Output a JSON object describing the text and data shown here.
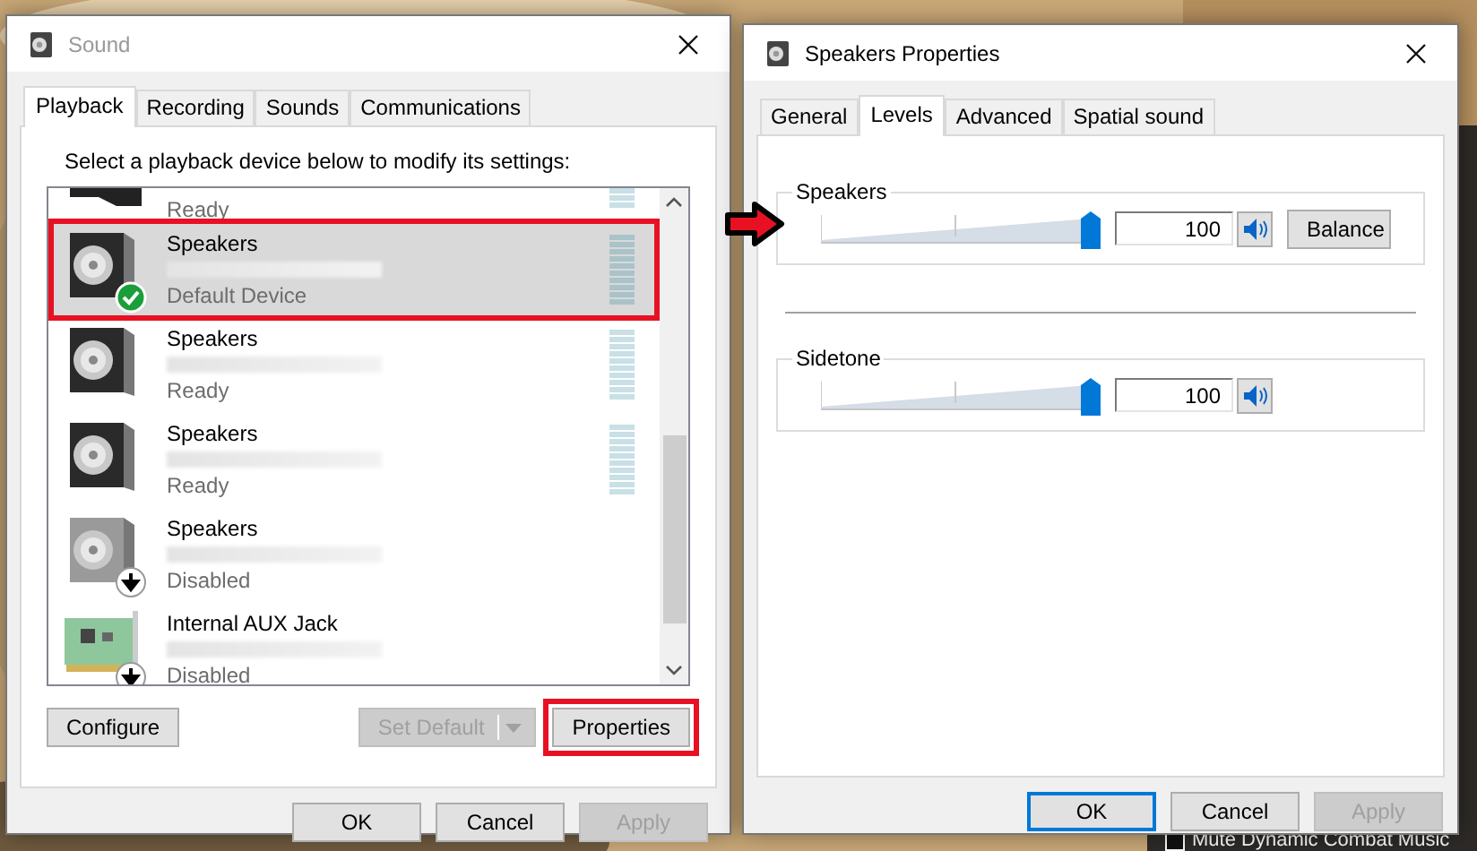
{
  "sound_window": {
    "title": "Sound",
    "tabs": [
      {
        "label": "Playback",
        "selected": true
      },
      {
        "label": "Recording",
        "selected": false
      },
      {
        "label": "Sounds",
        "selected": false
      },
      {
        "label": "Communications",
        "selected": false
      }
    ],
    "instruction": "Select a playback device below to modify its settings:",
    "devices": [
      {
        "kind": "monitor",
        "status": "Ready",
        "selected": false,
        "highlighted": false
      },
      {
        "kind": "speaker",
        "name": "Speakers",
        "status": "Default Device",
        "default": true,
        "disabled": false,
        "selected": true,
        "highlighted": true
      },
      {
        "kind": "speaker",
        "name": "Speakers",
        "status": "Ready",
        "default": false,
        "disabled": false,
        "selected": false,
        "highlighted": false
      },
      {
        "kind": "speaker",
        "name": "Speakers",
        "status": "Ready",
        "default": false,
        "disabled": false,
        "selected": false,
        "highlighted": false
      },
      {
        "kind": "speaker",
        "name": "Speakers",
        "status": "Disabled",
        "default": false,
        "disabled": true,
        "selected": false,
        "highlighted": false
      },
      {
        "kind": "card",
        "name": "Internal AUX Jack",
        "status": "Disabled",
        "default": false,
        "disabled": true,
        "selected": false,
        "highlighted": false
      }
    ],
    "buttons": [
      {
        "label": "Configure",
        "disabled": false
      },
      {
        "label": "Set Default",
        "disabled": true,
        "dropdown": true
      },
      {
        "label": "Properties",
        "disabled": false,
        "highlighted": true
      }
    ],
    "dialog_buttons": [
      {
        "label": "OK",
        "disabled": false,
        "default": false
      },
      {
        "label": "Cancel",
        "disabled": false,
        "default": false
      },
      {
        "label": "Apply",
        "disabled": true,
        "default": false
      }
    ]
  },
  "properties_window": {
    "title": "Speakers Properties",
    "tabs": [
      {
        "label": "General",
        "selected": false
      },
      {
        "label": "Levels",
        "selected": true
      },
      {
        "label": "Advanced",
        "selected": false
      },
      {
        "label": "Spatial sound",
        "selected": false
      }
    ],
    "levels": [
      {
        "label": "Speakers",
        "level": 1,
        "reading": "100",
        "muted": false,
        "balance": "Balance",
        "pointed": true
      },
      {
        "label": "Sidetone",
        "level": 1,
        "reading": "100",
        "muted": false
      }
    ],
    "dialog_buttons": [
      {
        "label": "OK",
        "disabled": false,
        "default": true
      },
      {
        "label": "Cancel",
        "disabled": false,
        "default": false
      },
      {
        "label": "Apply",
        "disabled": true,
        "default": false
      }
    ]
  },
  "desktop": {
    "label": "Mute Dynamic Combat Music",
    "checked": false
  }
}
